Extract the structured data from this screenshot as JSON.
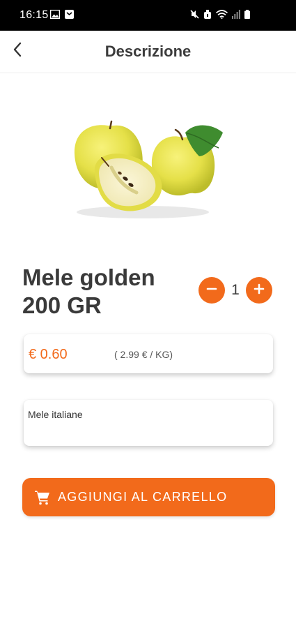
{
  "status_bar": {
    "time": "16:15",
    "left_icons": [
      "image-icon",
      "notification-icon"
    ],
    "right_icons": [
      "mute-icon",
      "alarm-icon",
      "wifi-icon",
      "signal-icon",
      "battery-icon"
    ]
  },
  "app_bar": {
    "back_icon": "chevron-left-icon",
    "title": "Descrizione"
  },
  "product": {
    "image": "golden-apples-image",
    "title_line1": "Mele golden",
    "title_line2": "200 GR",
    "quantity": "1",
    "price": "€ 0.60",
    "price_per_kg": "( 2.99 € / KG)",
    "description": "Mele italiane"
  },
  "actions": {
    "add_to_cart_label": "AGGIUNGI AL CARRELLO",
    "cart_icon": "cart-icon"
  },
  "colors": {
    "accent": "#f26a1b",
    "status_bar": "#000000",
    "text": "#3a3a3a"
  }
}
